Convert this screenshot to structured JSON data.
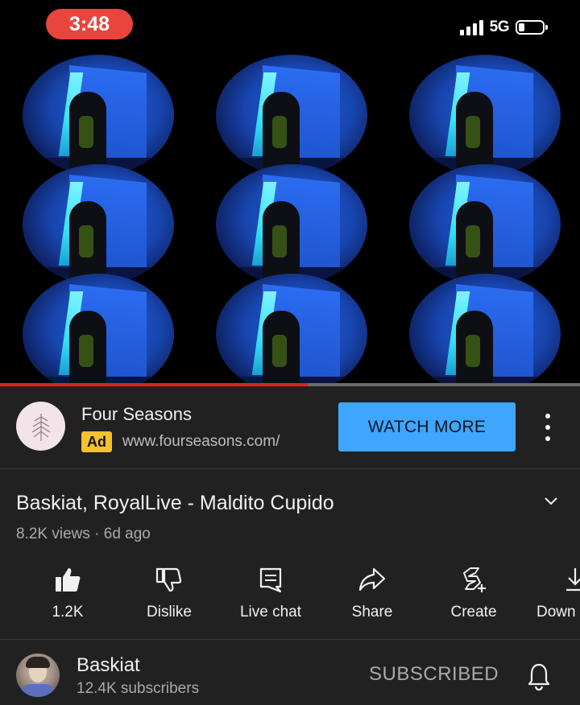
{
  "status_bar": {
    "time": "3:48",
    "network": "5G",
    "time_pill_color": "#e8453c"
  },
  "video": {
    "progress": 0.53,
    "progress_color": "#e02020"
  },
  "ad": {
    "advertiser": "Four Seasons",
    "badge": "Ad",
    "url": "www.fourseasons.com/",
    "cta_label": "WATCH MORE",
    "cta_color": "#3ea6ff",
    "badge_color": "#f6c12d",
    "logo_icon": "tree-leaf-icon",
    "menu_icon": "more-vertical-icon"
  },
  "video_info": {
    "title": "Baskiat, RoyalLive - Maldito Cupido",
    "views": "8.2K views",
    "separator": "·",
    "age": "6d ago",
    "expand_icon": "chevron-down-icon"
  },
  "actions": [
    {
      "label": "1.2K",
      "icon": "thumbs-up-icon"
    },
    {
      "label": "Dislike",
      "icon": "thumbs-down-icon"
    },
    {
      "label": "Live chat",
      "icon": "chat-icon"
    },
    {
      "label": "Share",
      "icon": "share-icon"
    },
    {
      "label": "Create",
      "icon": "create-icon"
    },
    {
      "label": "Down",
      "icon": "download-icon"
    }
  ],
  "channel": {
    "name": "Baskiat",
    "subscribers": "12.4K subscribers",
    "subscribe_label": "SUBSCRIBED",
    "bell_icon": "bell-icon"
  }
}
